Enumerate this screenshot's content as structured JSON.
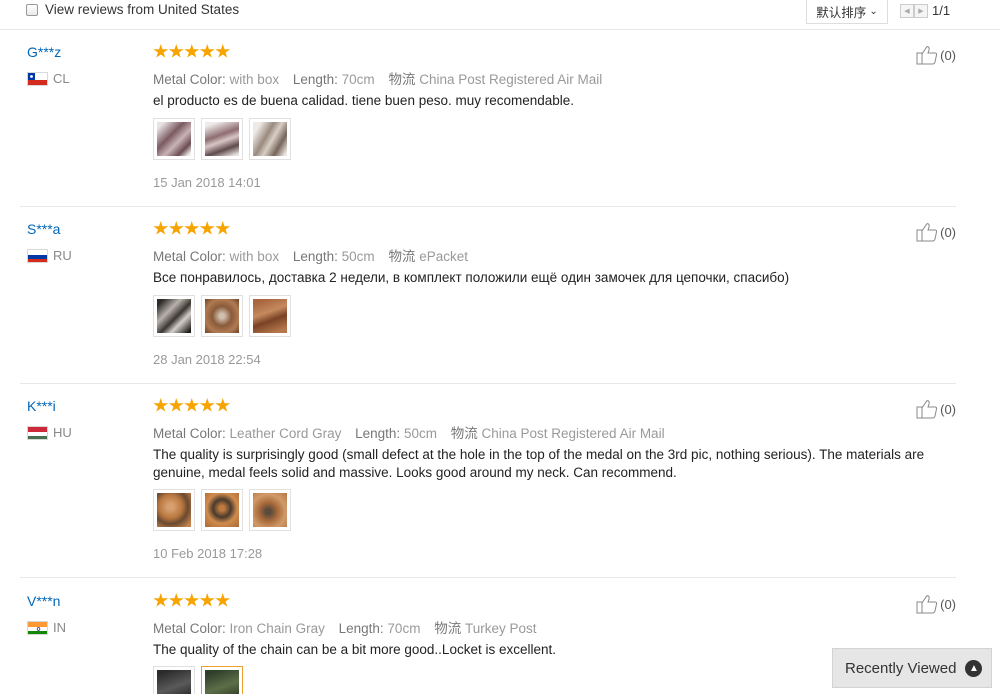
{
  "filter": {
    "label": "View reviews from United States"
  },
  "sort": {
    "label": "默认排序"
  },
  "pager": {
    "text": "1/1"
  },
  "reviews": [
    {
      "user": "G***z",
      "country": "CL",
      "rating": 5,
      "attrs": [
        {
          "k": "Metal Color:",
          "v": "with box"
        },
        {
          "k": "Length:",
          "v": "70cm"
        },
        {
          "k": "物流",
          "v": "China Post Registered Air Mail"
        }
      ],
      "text": "el producto es de buena calidad. tiene buen peso. muy recomendable.",
      "photos": [
        "review-photo",
        "review-photo",
        "review-photo"
      ],
      "date": "15 Jan 2018 14:01",
      "helpful": "(0)"
    },
    {
      "user": "S***a",
      "country": "RU",
      "rating": 5,
      "attrs": [
        {
          "k": "Metal Color:",
          "v": "with box"
        },
        {
          "k": "Length:",
          "v": "50cm"
        },
        {
          "k": "物流",
          "v": "ePacket"
        }
      ],
      "text": "Все понравилось, доставка 2 недели, в комплект положили ещё один замочек для цепочки, спасибо)",
      "photos": [
        "review-photo",
        "review-photo",
        "review-photo"
      ],
      "date": "28 Jan 2018 22:54",
      "helpful": "(0)"
    },
    {
      "user": "K***i",
      "country": "HU",
      "rating": 5,
      "attrs": [
        {
          "k": "Metal Color:",
          "v": "Leather Cord Gray"
        },
        {
          "k": "Length:",
          "v": "50cm"
        },
        {
          "k": "物流",
          "v": "China Post Registered Air Mail"
        }
      ],
      "text": "The quality is surprisingly good (small defect at the hole in the top of the medal on the 3rd pic, nothing serious). The materials are genuine, medal feels solid and massive. Looks good around my neck. Can recommend.",
      "photos": [
        "review-photo",
        "review-photo",
        "review-photo"
      ],
      "date": "10 Feb 2018 17:28",
      "helpful": "(0)"
    },
    {
      "user": "V***n",
      "country": "IN",
      "rating": 5,
      "attrs": [
        {
          "k": "Metal Color:",
          "v": "Iron Chain Gray"
        },
        {
          "k": "Length:",
          "v": "70cm"
        },
        {
          "k": "物流",
          "v": "Turkey Post"
        }
      ],
      "text": "The quality of the chain can be a bit more good..Locket is excellent.",
      "photos": [
        "review-photo",
        "review-photo"
      ],
      "date": "",
      "helpful": "(0)"
    }
  ],
  "recently_viewed": {
    "label": "Recently Viewed"
  }
}
